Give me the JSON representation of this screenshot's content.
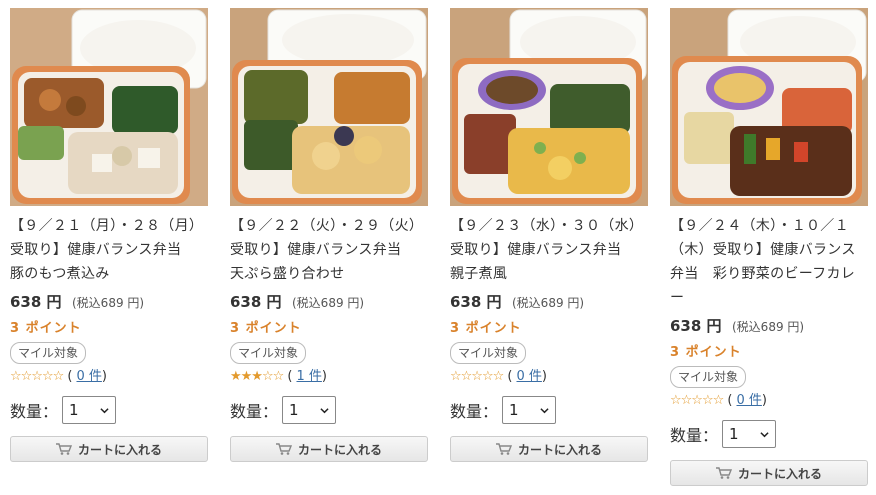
{
  "products": [
    {
      "title": "【９／２１（月）・２８（月）受取り】健康バランス弁当　豚のもつ煮込み",
      "price": "638 円",
      "tax": "(税込689 円)",
      "points": "3 ポイント",
      "badge": "マイル対象",
      "rating": 0,
      "reviews": "0 件",
      "qty_label": "数量：",
      "qty_value": "1",
      "cart_label": "カートに入れる",
      "image_icon": "bento-box-photo"
    },
    {
      "title": "【９／２２（火）・２９（火）受取り】健康バランス弁当　天ぷら盛り合わせ",
      "price": "638 円",
      "tax": "(税込689 円)",
      "points": "3 ポイント",
      "badge": "マイル対象",
      "rating": 3,
      "reviews": "1 件",
      "qty_label": "数量：",
      "qty_value": "1",
      "cart_label": "カートに入れる",
      "image_icon": "bento-box-photo"
    },
    {
      "title": "【９／２３（水）・３０（水）受取り】健康バランス弁当　親子煮風",
      "price": "638 円",
      "tax": "(税込689 円)",
      "points": "3 ポイント",
      "badge": "マイル対象",
      "rating": 0,
      "reviews": "0 件",
      "qty_label": "数量：",
      "qty_value": "1",
      "cart_label": "カートに入れる",
      "image_icon": "bento-box-photo"
    },
    {
      "title": "【９／２４（木）・１０／１（木）受取り】健康バランス弁当　彩り野菜のビーフカレー",
      "price": "638 円",
      "tax": "(税込689 円)",
      "points": "3 ポイント",
      "badge": "マイル対象",
      "rating": 0,
      "reviews": "0 件",
      "qty_label": "数量：",
      "qty_value": "1",
      "cart_label": "カートに入れる",
      "image_icon": "bento-box-photo"
    }
  ],
  "colors": {
    "points": "#d9822b",
    "star": "#e39a2d",
    "link": "#3a6ea5",
    "tray": "#d9824a"
  }
}
